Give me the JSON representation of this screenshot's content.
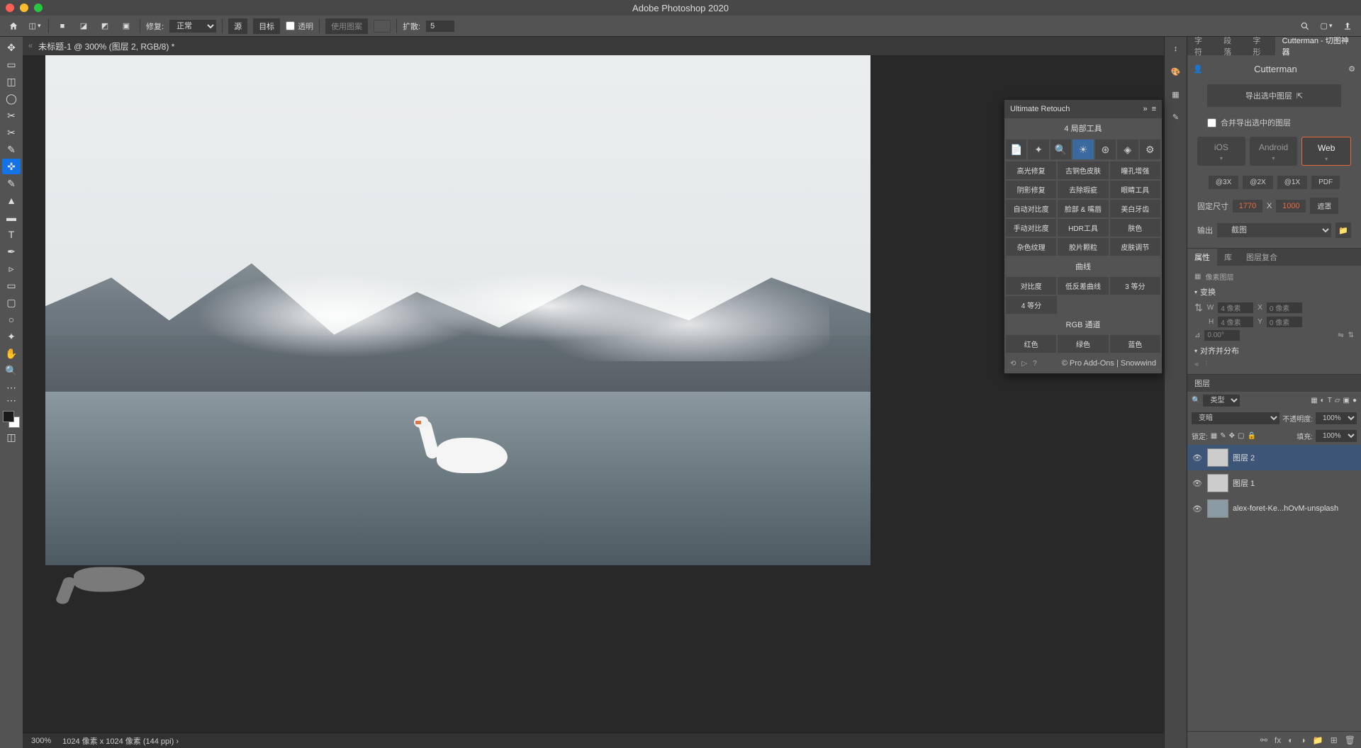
{
  "app": {
    "title": "Adobe Photoshop 2020"
  },
  "optionsBar": {
    "repairLabel": "修复:",
    "repairMode": "正常",
    "source": "源",
    "target": "目标",
    "transparent": "透明",
    "usePattern": "使用图案",
    "diffusion": "扩散:",
    "diffusionValue": "5"
  },
  "document": {
    "tab": "未标题-1 @ 300% (图层 2, RGB/8) *"
  },
  "statusBar": {
    "zoom": "300%",
    "dims": "1024 像素 x 1024 像素 (144 ppi)"
  },
  "floatingPanel": {
    "title": "Ultimate Retouch",
    "sectionLocal": "4 局部工具",
    "rows": [
      [
        "高光修复",
        "古铜色皮肤",
        "瞳孔增强"
      ],
      [
        "阴影修复",
        "去除瑕疵",
        "眼睛工具"
      ],
      [
        "自动对比度",
        "脸部 & 嘴唇",
        "美白牙齿"
      ],
      [
        "手动对比度",
        "HDR工具",
        "肤色"
      ],
      [
        "杂色纹理",
        "胶片颗粒",
        "皮肤调节"
      ]
    ],
    "curves": "曲线",
    "curveRow": [
      "对比度",
      "低反差曲线",
      "3 等分"
    ],
    "curveExtra": "4 等分",
    "rgb": "RGB 通道",
    "rgbRow": [
      "红色",
      "绿色",
      "蓝色"
    ],
    "credit": "© Pro Add-Ons | Snowwind"
  },
  "rightTabs": {
    "char": "字符",
    "para": "段落",
    "glyph": "字形",
    "cut": "Cutterman - 切图神器"
  },
  "cutterman": {
    "title": "Cutterman",
    "exportBtn": "导出选中图层",
    "mergeExport": "合并导出选中的图层",
    "platforms": [
      "iOS",
      "Android",
      "Web"
    ],
    "sizes": [
      "@3X",
      "@2X",
      "@1X",
      "PDF"
    ],
    "fixedLabel": "固定尺寸",
    "width": "1770",
    "height": "1000",
    "mask": "遮罩",
    "outputLabel": "输出",
    "outputMode": "截图"
  },
  "propsTabs": {
    "props": "属性",
    "lib": "库",
    "comp": "图层复合"
  },
  "properties": {
    "pixelLayer": "像素图层",
    "transform": "变换",
    "wLabel": "W",
    "wVal": "4 像素",
    "xLabel": "X",
    "xVal": "0 像素",
    "hLabel": "H",
    "hVal": "4 像素",
    "yLabel": "Y",
    "yVal": "0 像素",
    "angle": "0.00°",
    "align": "对齐并分布"
  },
  "layersPanel": {
    "title": "图层",
    "kindLabel": "类型",
    "blend": "变暗",
    "opacityLabel": "不透明度:",
    "opacity": "100%",
    "lockLabel": "锁定:",
    "fillLabel": "填充:",
    "fill": "100%",
    "layers": [
      {
        "name": "图层 2",
        "active": true
      },
      {
        "name": "图层 1",
        "active": false
      },
      {
        "name": "alex-foret-Ke...hOvM-unsplash",
        "active": false
      }
    ]
  }
}
